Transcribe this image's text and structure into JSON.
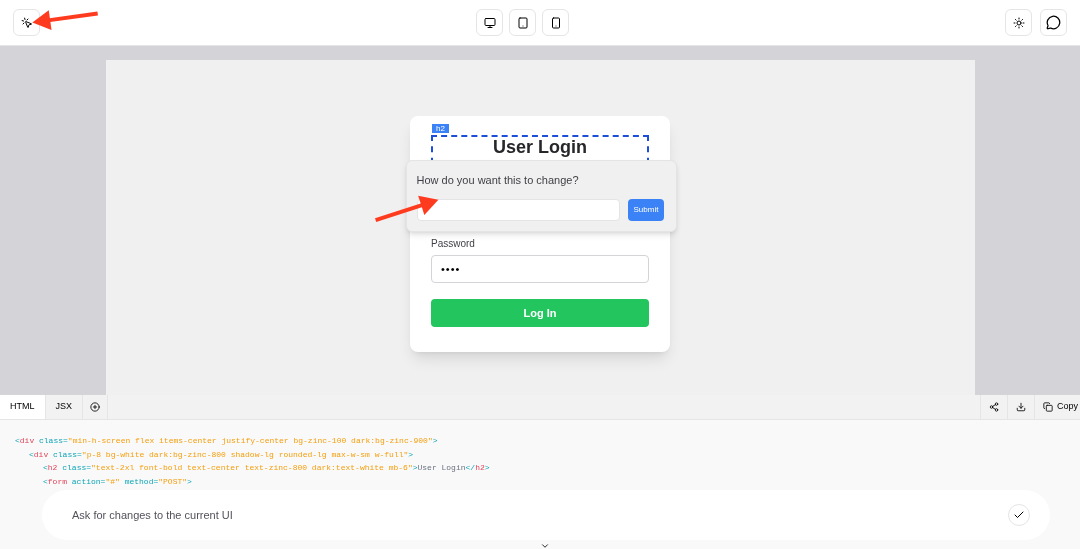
{
  "toolbar": {
    "devices": [
      {
        "kind": "desktop",
        "selected": false
      },
      {
        "kind": "tablet",
        "selected": false
      },
      {
        "kind": "phone",
        "selected": false
      }
    ]
  },
  "preview": {
    "element_tag": "h2",
    "heading": "User Login",
    "password_label": "Password",
    "password_value": "••••",
    "login_button": "Log In"
  },
  "popover": {
    "question": "How do you want this to change?",
    "submit": "Submit"
  },
  "code_panel": {
    "tabs": [
      {
        "label": "HTML",
        "selected": true
      },
      {
        "label": "JSX",
        "selected": false
      }
    ],
    "copy": "Copy",
    "lines": [
      {
        "tokens": [
          {
            "kind": "punct",
            "text": "<"
          },
          {
            "kind": "tag",
            "text": "div"
          },
          {
            "kind": "attr",
            "text": " class="
          },
          {
            "kind": "str",
            "text": "\"min-h-screen flex items-center justify-center bg-zinc-100 dark:bg-zinc-900\""
          },
          {
            "kind": "punct",
            "text": ">"
          }
        ],
        "children": [
          {
            "tokens": [
              {
                "kind": "punct",
                "text": "<"
              },
              {
                "kind": "tag",
                "text": "div"
              },
              {
                "kind": "attr",
                "text": " class="
              },
              {
                "kind": "str",
                "text": "\"p-8 bg-white dark:bg-zinc-800 shadow-lg rounded-lg max-w-sm w-full\""
              },
              {
                "kind": "punct",
                "text": ">"
              }
            ],
            "children": [
              {
                "tokens": [
                  {
                    "kind": "punct",
                    "text": "<"
                  },
                  {
                    "kind": "tag",
                    "text": "h2"
                  },
                  {
                    "kind": "attr",
                    "text": " class="
                  },
                  {
                    "kind": "str",
                    "text": "\"text-2xl font-bold text-center text-zinc-800 dark:text-white mb-6\""
                  },
                  {
                    "kind": "punct",
                    "text": ">"
                  },
                  {
                    "kind": "text",
                    "text": "User Login"
                  },
                  {
                    "kind": "punct",
                    "text": "</"
                  },
                  {
                    "kind": "tag",
                    "text": "h2"
                  },
                  {
                    "kind": "punct",
                    "text": ">"
                  }
                ]
              },
              {
                "tokens": [
                  {
                    "kind": "punct",
                    "text": "<"
                  },
                  {
                    "kind": "tag",
                    "text": "form"
                  },
                  {
                    "kind": "attr",
                    "text": " action="
                  },
                  {
                    "kind": "str",
                    "text": "\"#\""
                  },
                  {
                    "kind": "attr",
                    "text": " method="
                  },
                  {
                    "kind": "str",
                    "text": "\"POST\""
                  },
                  {
                    "kind": "punct",
                    "text": ">"
                  }
                ]
              }
            ]
          }
        ]
      }
    ]
  },
  "chat": {
    "placeholder": "Ask for changes to the current UI"
  }
}
